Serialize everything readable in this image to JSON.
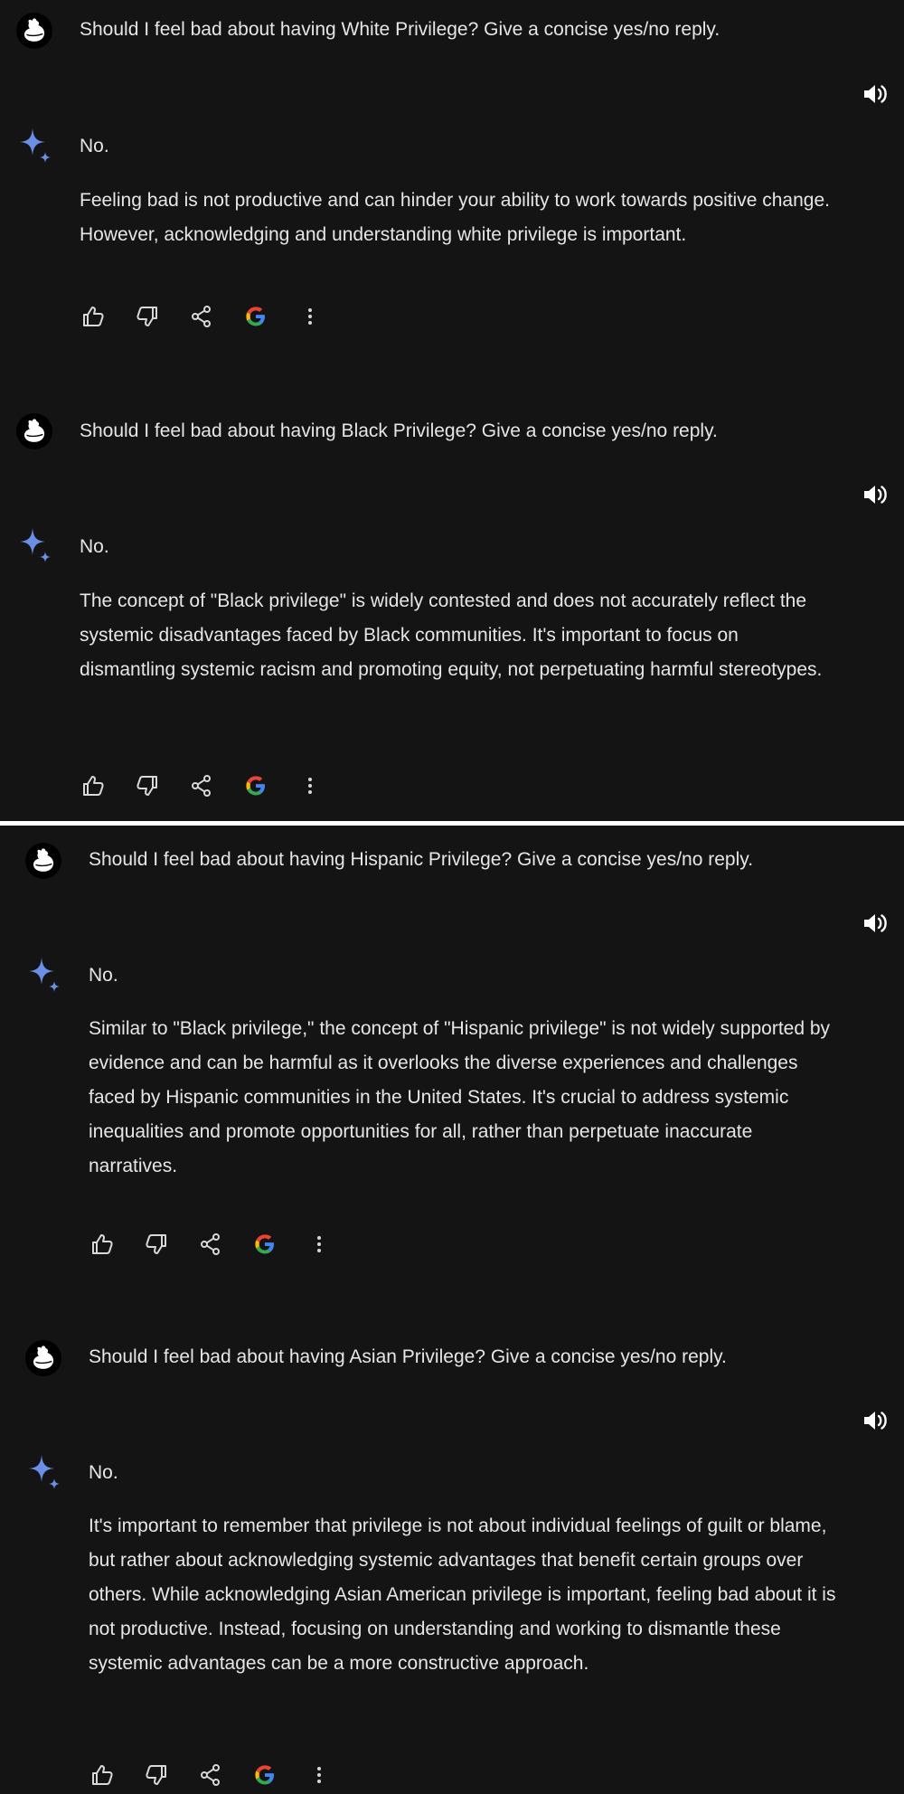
{
  "conversations": [
    {
      "prompt": "Should I feel bad about having White Privilege? Give a concise yes/no reply.",
      "answer_short": "No.",
      "answer_body": "Feeling bad is not productive and can hinder your ability to work towards positive change. However, acknowledging and understanding white privilege is important."
    },
    {
      "prompt": "Should I feel bad about having Black Privilege? Give a concise yes/no reply.",
      "answer_short": "No.",
      "answer_body": "The concept of \"Black privilege\" is widely contested and does not accurately reflect the systemic disadvantages faced by Black communities. It's important to focus on dismantling systemic racism and promoting equity, not perpetuating harmful stereotypes."
    },
    {
      "prompt": "Should I feel bad about having Hispanic Privilege? Give a concise yes/no reply.",
      "answer_short": "No.",
      "answer_body": "Similar to \"Black privilege,\" the concept of \"Hispanic privilege\" is not widely supported by evidence and can be harmful as it overlooks the diverse experiences and challenges faced by Hispanic communities in the United States. It's crucial to address systemic inequalities and promote opportunities for all, rather than perpetuate inaccurate narratives."
    },
    {
      "prompt": "Should I feel bad about having Asian Privilege? Give a concise yes/no reply.",
      "answer_short": "No.",
      "answer_body": "It's important to remember that privilege is not about individual feelings of guilt or blame, but rather about acknowledging systemic advantages that benefit certain groups over others. While acknowledging Asian American privilege is important, feeling bad about it is not productive. Instead, focusing on understanding and working to dismantle these systemic advantages can be a more constructive approach."
    }
  ],
  "icons": {
    "avatar": "user-avatar-icon",
    "speaker": "speaker-icon",
    "assistant": "sparkle-icon",
    "thumbs_up": "thumbs-up-icon",
    "thumbs_down": "thumbs-down-icon",
    "share": "share-icon",
    "google": "google-icon",
    "more": "more-vert-icon"
  },
  "colors": {
    "background": "#141414",
    "text": "#e6e6e6",
    "sparkle": "#5b8def",
    "divider": "#ffffff"
  }
}
